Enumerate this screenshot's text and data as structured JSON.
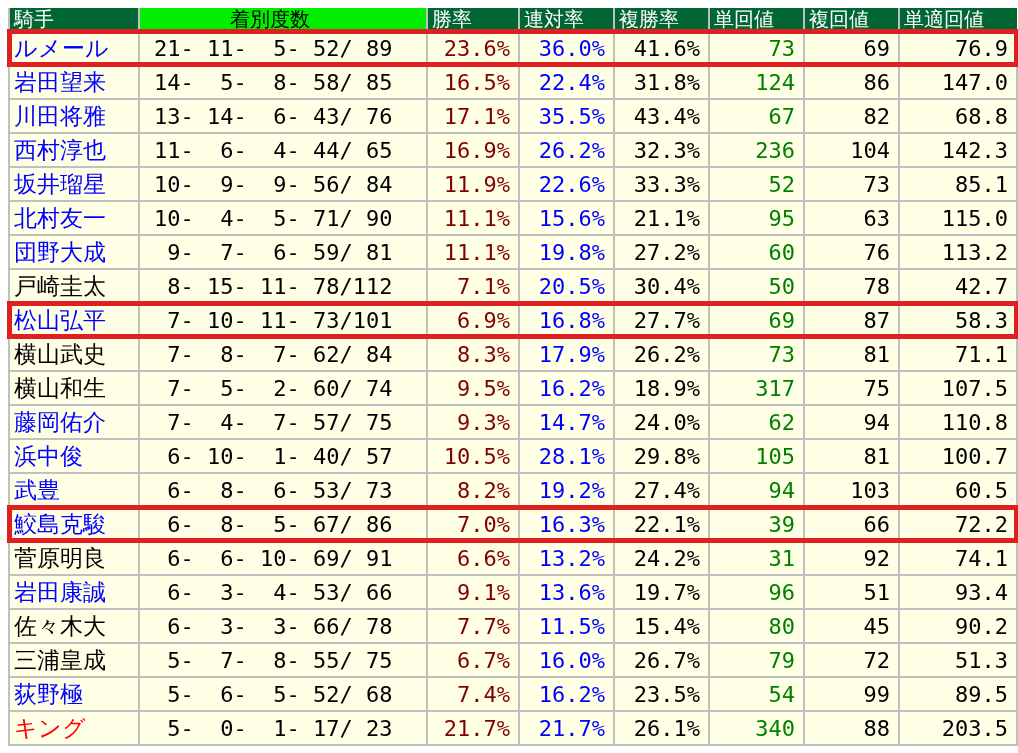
{
  "columns": [
    "騎手",
    "着別度数",
    "勝率",
    "連対率",
    "複勝率",
    "単回値",
    "複回値",
    "単適回値"
  ],
  "rows": [
    {
      "name": "ルメール",
      "color": "#0000ff",
      "highlighted": true,
      "record": "21- 11-  5- 52/ 89",
      "win": "23.6%",
      "top2": "36.0%",
      "top3": "41.6%",
      "win_ret": "73",
      "place_ret": "69",
      "adj_ret": "76.9"
    },
    {
      "name": "岩田望来",
      "color": "#0000ff",
      "highlighted": false,
      "record": "14-  5-  8- 58/ 85",
      "win": "16.5%",
      "top2": "22.4%",
      "top3": "31.8%",
      "win_ret": "124",
      "place_ret": "86",
      "adj_ret": "147.0"
    },
    {
      "name": "川田将雅",
      "color": "#0000ff",
      "highlighted": false,
      "record": "13- 14-  6- 43/ 76",
      "win": "17.1%",
      "top2": "35.5%",
      "top3": "43.4%",
      "win_ret": "67",
      "place_ret": "82",
      "adj_ret": "68.8"
    },
    {
      "name": "西村淳也",
      "color": "#0000ff",
      "highlighted": false,
      "record": "11-  6-  4- 44/ 65",
      "win": "16.9%",
      "top2": "26.2%",
      "top3": "32.3%",
      "win_ret": "236",
      "place_ret": "104",
      "adj_ret": "142.3"
    },
    {
      "name": "坂井瑠星",
      "color": "#0000ff",
      "highlighted": false,
      "record": "10-  9-  9- 56/ 84",
      "win": "11.9%",
      "top2": "22.6%",
      "top3": "33.3%",
      "win_ret": "52",
      "place_ret": "73",
      "adj_ret": "85.1"
    },
    {
      "name": "北村友一",
      "color": "#0000ff",
      "highlighted": false,
      "record": "10-  4-  5- 71/ 90",
      "win": "11.1%",
      "top2": "15.6%",
      "top3": "21.1%",
      "win_ret": "95",
      "place_ret": "63",
      "adj_ret": "115.0"
    },
    {
      "name": "団野大成",
      "color": "#0000ff",
      "highlighted": false,
      "record": " 9-  7-  6- 59/ 81",
      "win": "11.1%",
      "top2": "19.8%",
      "top3": "27.2%",
      "win_ret": "60",
      "place_ret": "76",
      "adj_ret": "113.2"
    },
    {
      "name": "戸崎圭太",
      "color": "#000000",
      "highlighted": false,
      "record": " 8- 15- 11- 78/112",
      "win": "7.1%",
      "top2": "20.5%",
      "top3": "30.4%",
      "win_ret": "50",
      "place_ret": "78",
      "adj_ret": "42.7"
    },
    {
      "name": "松山弘平",
      "color": "#0000ff",
      "highlighted": true,
      "record": " 7- 10- 11- 73/101",
      "win": "6.9%",
      "top2": "16.8%",
      "top3": "27.7%",
      "win_ret": "69",
      "place_ret": "87",
      "adj_ret": "58.3"
    },
    {
      "name": "横山武史",
      "color": "#000000",
      "highlighted": false,
      "record": " 7-  8-  7- 62/ 84",
      "win": "8.3%",
      "top2": "17.9%",
      "top3": "26.2%",
      "win_ret": "73",
      "place_ret": "81",
      "adj_ret": "71.1"
    },
    {
      "name": "横山和生",
      "color": "#000000",
      "highlighted": false,
      "record": " 7-  5-  2- 60/ 74",
      "win": "9.5%",
      "top2": "16.2%",
      "top3": "18.9%",
      "win_ret": "317",
      "place_ret": "75",
      "adj_ret": "107.5"
    },
    {
      "name": "藤岡佑介",
      "color": "#0000ff",
      "highlighted": false,
      "record": " 7-  4-  7- 57/ 75",
      "win": "9.3%",
      "top2": "14.7%",
      "top3": "24.0%",
      "win_ret": "62",
      "place_ret": "94",
      "adj_ret": "110.8"
    },
    {
      "name": "浜中俊",
      "color": "#0000ff",
      "highlighted": false,
      "record": " 6- 10-  1- 40/ 57",
      "win": "10.5%",
      "top2": "28.1%",
      "top3": "29.8%",
      "win_ret": "105",
      "place_ret": "81",
      "adj_ret": "100.7"
    },
    {
      "name": "武豊",
      "color": "#0000ff",
      "highlighted": false,
      "record": " 6-  8-  6- 53/ 73",
      "win": "8.2%",
      "top2": "19.2%",
      "top3": "27.4%",
      "win_ret": "94",
      "place_ret": "103",
      "adj_ret": "60.5"
    },
    {
      "name": "鮫島克駿",
      "color": "#0000ff",
      "highlighted": true,
      "record": " 6-  8-  5- 67/ 86",
      "win": "7.0%",
      "top2": "16.3%",
      "top3": "22.1%",
      "win_ret": "39",
      "place_ret": "66",
      "adj_ret": "72.2"
    },
    {
      "name": "菅原明良",
      "color": "#000000",
      "highlighted": false,
      "record": " 6-  6- 10- 69/ 91",
      "win": "6.6%",
      "top2": "13.2%",
      "top3": "24.2%",
      "win_ret": "31",
      "place_ret": "92",
      "adj_ret": "74.1"
    },
    {
      "name": "岩田康誠",
      "color": "#0000ff",
      "highlighted": false,
      "record": " 6-  3-  4- 53/ 66",
      "win": "9.1%",
      "top2": "13.6%",
      "top3": "19.7%",
      "win_ret": "96",
      "place_ret": "51",
      "adj_ret": "93.4"
    },
    {
      "name": "佐々木大",
      "color": "#000000",
      "highlighted": false,
      "record": " 6-  3-  3- 66/ 78",
      "win": "7.7%",
      "top2": "11.5%",
      "top3": "15.4%",
      "win_ret": "80",
      "place_ret": "45",
      "adj_ret": "90.2"
    },
    {
      "name": "三浦皇成",
      "color": "#000000",
      "highlighted": false,
      "record": " 5-  7-  8- 55/ 75",
      "win": "6.7%",
      "top2": "16.0%",
      "top3": "26.7%",
      "win_ret": "79",
      "place_ret": "72",
      "adj_ret": "51.3"
    },
    {
      "name": "荻野極",
      "color": "#0000ff",
      "highlighted": false,
      "record": " 5-  6-  5- 52/ 68",
      "win": "7.4%",
      "top2": "16.2%",
      "top3": "23.5%",
      "win_ret": "54",
      "place_ret": "99",
      "adj_ret": "89.5"
    },
    {
      "name": "キング",
      "color": "#ff0000",
      "highlighted": false,
      "record": " 5-  0-  1- 17/ 23",
      "win": "21.7%",
      "top2": "21.7%",
      "top3": "26.1%",
      "win_ret": "340",
      "place_ret": "88",
      "adj_ret": "203.5"
    }
  ]
}
